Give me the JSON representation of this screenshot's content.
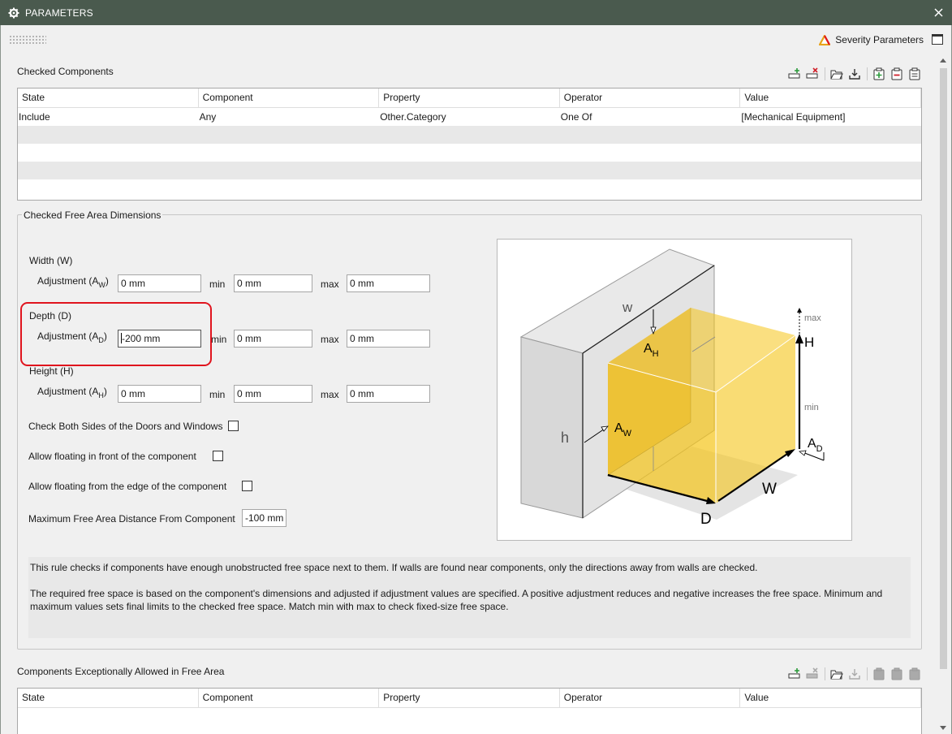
{
  "window": {
    "title": "PARAMETERS",
    "close_icon": "close-icon",
    "gear_icon": "gear-icon"
  },
  "header": {
    "severity_label": "Severity Parameters",
    "severity_icon": "warning-triangle-icon",
    "severity_icon_color": "#e8a31a"
  },
  "checked_components": {
    "label": "Checked Components",
    "columns": [
      "State",
      "Component",
      "Property",
      "Operator",
      "Value"
    ],
    "rows": [
      {
        "state": "Include",
        "component": "Any",
        "property": "Other.Category",
        "operator": "One Of",
        "value": "[Mechanical Equipment]"
      }
    ],
    "toolbar_icons": [
      "add-row-icon",
      "remove-row-icon",
      "open-folder-icon",
      "download-icon",
      "add-clipboard-icon",
      "remove-clipboard-icon",
      "clipboard-icon"
    ]
  },
  "free_area": {
    "legend": "Checked Free Area Dimensions",
    "width": {
      "heading": "Width (W)",
      "adj_label": "Adjustment (A",
      "adj_sub": "W",
      "adj_close": ")",
      "adj_value": "0 mm",
      "min_label": "min",
      "min_value": "0 mm",
      "max_label": "max",
      "max_value": "0 mm"
    },
    "depth": {
      "heading": "Depth (D)",
      "adj_label": "Adjustment (A",
      "adj_sub": "D",
      "adj_close": ")",
      "adj_value": "-200 mm",
      "min_label": "min",
      "min_value": "0 mm",
      "max_label": "max",
      "max_value": "0 mm"
    },
    "height": {
      "heading": "Height (H)",
      "adj_label": "Adjustment (A",
      "adj_sub": "H",
      "adj_close": ")",
      "adj_value": "0 mm",
      "min_label": "min",
      "min_value": "0 mm",
      "max_label": "max",
      "max_value": "0 mm"
    },
    "check_both_sides": {
      "label": "Check Both Sides of the Doors and Windows",
      "checked": false
    },
    "allow_front": {
      "label": "Allow floating in front of the component",
      "checked": false
    },
    "allow_edge": {
      "label": "Allow floating from the edge of the component",
      "checked": false
    },
    "max_distance": {
      "label": "Maximum Free Area Distance From Component",
      "value": "-100 mm"
    },
    "highlight_color": "#e0141e"
  },
  "diagram": {
    "w": "w",
    "h": "h",
    "A": "A",
    "H_sub": "H",
    "W_sub": "W",
    "D_sub": "D",
    "H": "H",
    "W": "W",
    "D": "D",
    "max": "max",
    "min": "min",
    "box_color": "#f5c518"
  },
  "description": {
    "p1": "This rule checks if components have enough unobstructed free space next to them. If walls are found near components, only the directions away from walls are checked.",
    "p2": "The required free space is based on the component's dimensions and adjusted if adjustment values are specified. A positive adjustment reduces and negative increases the free space. Minimum and maximum values sets final limits to the checked free space. Match min with max to check fixed-size free space."
  },
  "exceptions": {
    "label": "Components Exceptionally Allowed in Free Area",
    "columns": [
      "State",
      "Component",
      "Property",
      "Operator",
      "Value"
    ]
  }
}
